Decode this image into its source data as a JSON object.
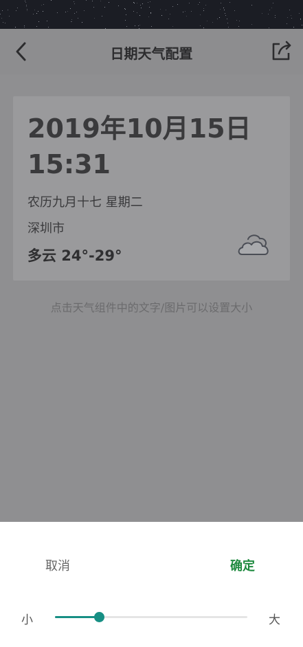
{
  "header": {
    "title": "日期天气配置",
    "back_icon": "chevron-left-icon",
    "share_icon": "share-export-icon"
  },
  "widget": {
    "date": "2019年10月15日",
    "time": "15:31",
    "lunar": "农历九月十七 星期二",
    "city": "深圳市",
    "weather": "多云 24°-29°",
    "weather_icon": "cloud-icon"
  },
  "hint": "点击天气组件中的文字/图片可以设置大小",
  "sheet": {
    "cancel_label": "取消",
    "confirm_label": "确定",
    "size_min_label": "小",
    "size_max_label": "大",
    "slider_value": 0.23
  },
  "colors": {
    "accent": "#178f84",
    "confirm": "#1f8a3f",
    "overlay": "#8f8f91"
  }
}
